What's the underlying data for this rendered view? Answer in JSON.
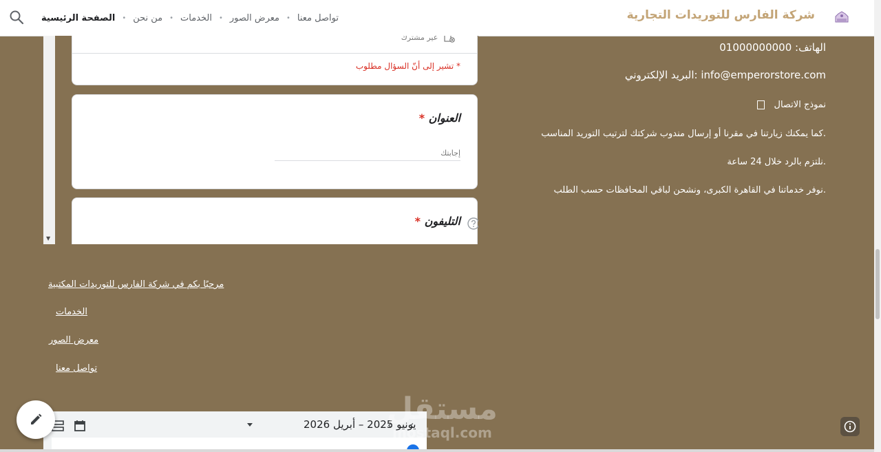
{
  "header": {
    "brand": "شركة الفارس للتوريدات التجارية",
    "nav": [
      {
        "label": "الصفحة الرئيسية",
        "active": true
      },
      {
        "label": "من نحن",
        "active": false
      },
      {
        "label": "الخدمات",
        "active": false
      },
      {
        "label": "معرض الصور",
        "active": false
      },
      {
        "label": "تواصل معنا",
        "active": false
      }
    ]
  },
  "form": {
    "share_status": "غير مشترك",
    "required_note": "* تشير إلى أنّ السؤال مطلوب",
    "questions": [
      {
        "title": "العنوان",
        "required_mark": "*",
        "placeholder": "إجابتك"
      },
      {
        "title": "التليفون",
        "required_mark": "*"
      }
    ]
  },
  "contact": {
    "phone": "الهاتف: 01000000000",
    "email": "info@emperorstore.com :البريد الإلكتروني",
    "form_link": "نموذج الاتصال",
    "line4": ".كما يمكنك زيارتنا في مقرنا أو إرسال مندوب شركتك لترتيب التوريد المناسب",
    "line5": ".نلتزم بالرد خلال 24 ساعة",
    "line6": ".نوفر خدماتنا في القاهرة الكبرى، ونشحن لباقي المحافظات حسب الطلب"
  },
  "footer_links": [
    "مرحبًا بكم في شركة الفارس للتوريدات المكتبية",
    "الخدمات",
    "معرض الصور",
    "تواصل معنا"
  ],
  "calendar": {
    "range": "يونيو 2025 – أبريل 2026"
  },
  "watermark": {
    "arabic": "مستقل",
    "latin": "mostaql.com"
  },
  "colors": {
    "background": "#857152",
    "brand": "#c3a476",
    "required": "#d93025"
  }
}
